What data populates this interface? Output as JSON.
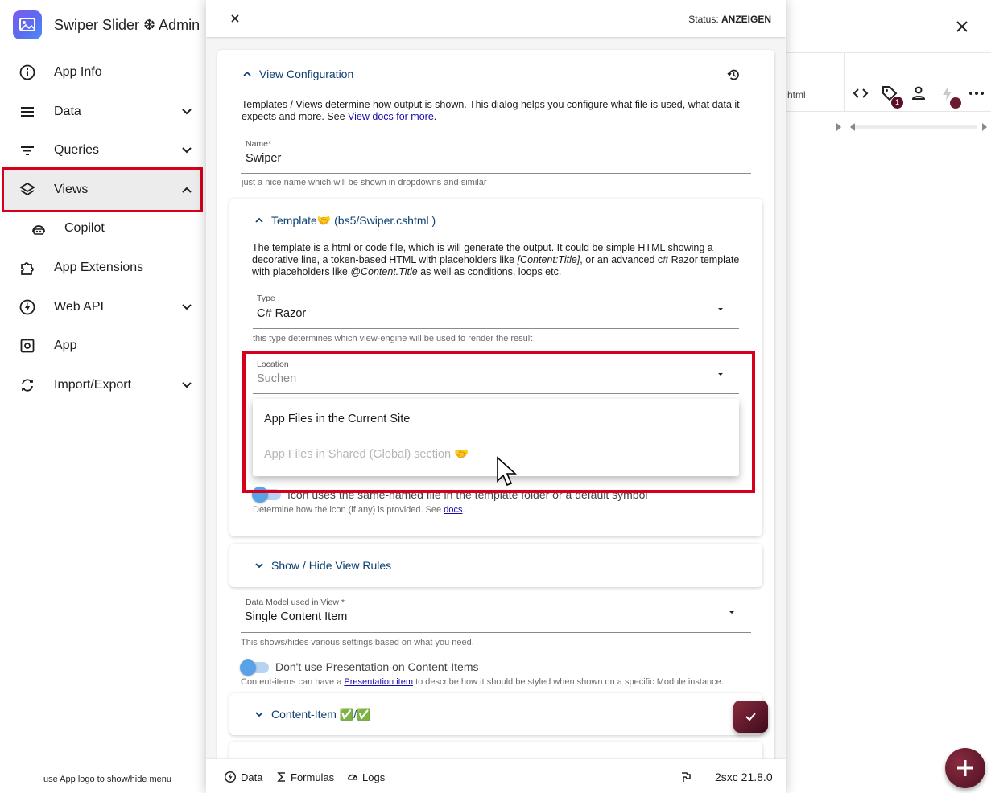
{
  "app": {
    "title": "Swiper Slider ❆ Admin",
    "sidebar_hint": "use App logo to show/hide menu"
  },
  "sidebar": {
    "items": [
      {
        "label": "App Info",
        "icon": "info-icon",
        "has_chevron": false
      },
      {
        "label": "Data",
        "icon": "list-icon",
        "has_chevron": true
      },
      {
        "label": "Queries",
        "icon": "filter-icon",
        "has_chevron": true
      },
      {
        "label": "Views",
        "icon": "layers-icon",
        "has_chevron": true,
        "expanded": true,
        "selected": true
      },
      {
        "label": "Copilot",
        "icon": "copilot-icon",
        "has_chevron": false,
        "child": true
      },
      {
        "label": "App Extensions",
        "icon": "puzzle-icon",
        "has_chevron": false
      },
      {
        "label": "Web API",
        "icon": "bolt-icon",
        "has_chevron": true
      },
      {
        "label": "App",
        "icon": "settings-box-icon",
        "has_chevron": false
      },
      {
        "label": "Import/Export",
        "icon": "import-export-icon",
        "has_chevron": true
      }
    ]
  },
  "background": {
    "cell_text": "html",
    "badge_count": "1"
  },
  "dialog": {
    "status_label": "Status: ",
    "status_value": "ANZEIGEN",
    "view_config": {
      "title": "View Configuration",
      "description": "Templates / Views determine how output is shown. This dialog helps you configure what file is used, what data it expects and more. See ",
      "docs_link": "View docs for more",
      "description_end": ".",
      "name_label": "Name*",
      "name_value": "Swiper",
      "name_help": "just a nice name which will be shown in dropdowns and similar"
    },
    "template": {
      "title": "Template🤝 (bs5/Swiper.cshtml )",
      "desc_part1": "The template is a html or code file, which is will generate the output. It could be simple HTML showing a decorative line, a token-based HTML with placeholders like ",
      "desc_italic1": "[Content:Title]",
      "desc_part2": ", or an advanced c# Razor template with placeholders like ",
      "desc_italic2": "@Content.Title",
      "desc_part3": " as well as conditions, loops etc.",
      "type_label": "Type",
      "type_value": "C# Razor",
      "type_help": "this type determines which view-engine will be used to render the result",
      "location_label": "Location",
      "location_placeholder": "Suchen",
      "location_options": [
        "App Files in the Current Site",
        "App Files in Shared (Global) section 🤝"
      ],
      "icon_toggle_text": "Icon uses the same-named file in the template folder or a default symbol",
      "icon_help": "Determine how the icon (if any) is provided. See ",
      "icon_help_link": "docs",
      "icon_help_end": "."
    },
    "show_hide": {
      "title": "Show / Hide View Rules"
    },
    "data_model": {
      "label": "Data Model used in View *",
      "value": "Single Content Item",
      "help": "This shows/hides various settings based on what you need."
    },
    "presentation": {
      "toggle_text": "Don't use Presentation on Content-Items",
      "help_part1": "Content-items can have a ",
      "help_link": "Presentation item",
      "help_part2": " to describe how it should be styled when shown on a specific Module instance."
    },
    "content_item": {
      "title": "Content-Item ✅/✅"
    },
    "footer": {
      "data": "Data",
      "formulas": "Formulas",
      "logs": "Logs",
      "version": "2sxc 21.8.0"
    }
  },
  "colors": {
    "highlight": "#d6001c",
    "accent_blue": "#0c3f72",
    "brand": "#6b1a30"
  }
}
